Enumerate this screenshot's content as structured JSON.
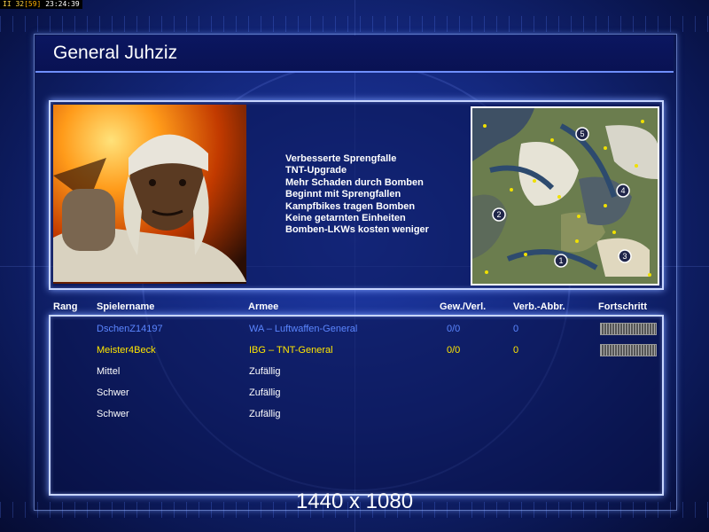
{
  "status_bar": {
    "a": "II",
    "b": "32",
    "c": "[59]",
    "time": "23:24:39"
  },
  "header": {
    "title": "General Juhziz"
  },
  "general": {
    "features": [
      "Verbesserte Sprengfalle",
      "TNT-Upgrade",
      "Mehr Schaden durch Bomben",
      "Beginnt mit Sprengfallen",
      "Kampfbikes tragen Bomben",
      "Keine getarnten Einheiten",
      "Bomben-LKWs kosten weniger"
    ]
  },
  "minimap": {
    "start_positions": [
      "1",
      "2",
      "3",
      "4",
      "5"
    ]
  },
  "table": {
    "headers": {
      "rank": "Rang",
      "player": "Spielername",
      "army": "Armee",
      "winloss": "Gew./Verl.",
      "loss_abort": "Verb.-Abbr.",
      "progress": "Fortschritt"
    },
    "rows": [
      {
        "player": "DschenZ14197",
        "army": "WA – Luftwaffen-General",
        "winloss": "0/0",
        "loss_abort": "0",
        "progress": 1.0,
        "color": "#5b86ff"
      },
      {
        "player": "Meister4Beck",
        "army": "IBG – TNT-General",
        "winloss": "0/0",
        "loss_abort": "0",
        "progress": 1.0,
        "color": "#ffe600"
      },
      {
        "player": "Mittel",
        "army": "Zufällig",
        "color": "#ffffff"
      },
      {
        "player": "Schwer",
        "army": "Zufällig",
        "color": "#ffffff"
      },
      {
        "player": "Schwer",
        "army": "Zufällig",
        "color": "#ffffff"
      }
    ]
  },
  "footer": {
    "resolution": "1440 x 1080"
  },
  "colors": {
    "accent": "#6f8fff",
    "background": "#14287e",
    "panel_border": "#c8d6ff"
  }
}
